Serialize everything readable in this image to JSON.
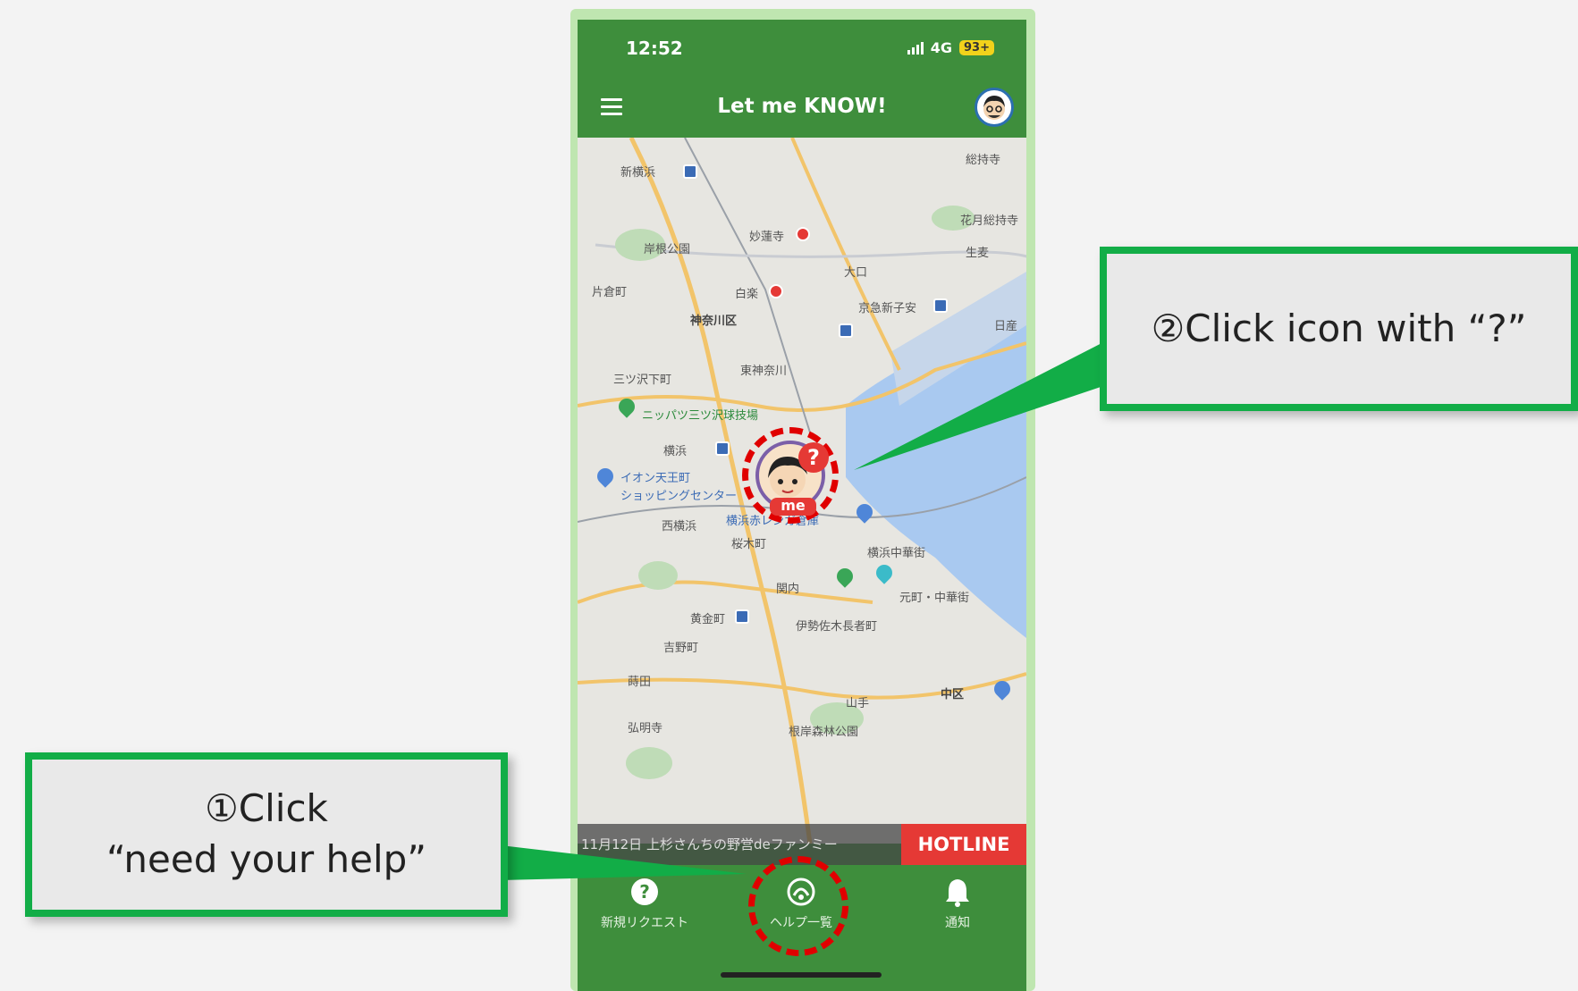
{
  "status": {
    "time": "12:52",
    "network": "4G",
    "battery": "93+"
  },
  "app_bar": {
    "title": "Let me KNOW!"
  },
  "map": {
    "labels": [
      {
        "text": "新横浜",
        "style": "",
        "anchor": "top-left"
      },
      {
        "text": "妙蓮寺",
        "style": ""
      },
      {
        "text": "岸根公園",
        "style": ""
      },
      {
        "text": "片倉町",
        "style": ""
      },
      {
        "text": "白楽",
        "style": ""
      },
      {
        "text": "神奈川区",
        "style": "bold"
      },
      {
        "text": "大口",
        "style": ""
      },
      {
        "text": "京急新子安",
        "style": ""
      },
      {
        "text": "東神奈川",
        "style": ""
      },
      {
        "text": "三ツ沢下町",
        "style": ""
      },
      {
        "text": "ニッパツ三ツ沢球技場",
        "style": "green"
      },
      {
        "text": "横浜",
        "style": ""
      },
      {
        "text": "イオン天王町",
        "style": "blue"
      },
      {
        "text": "ショッピングセンター",
        "style": "blue"
      },
      {
        "text": "西横浜",
        "style": ""
      },
      {
        "text": "横浜赤レンガ倉庫",
        "style": "blue"
      },
      {
        "text": "桜木町",
        "style": ""
      },
      {
        "text": "横浜中華街",
        "style": ""
      },
      {
        "text": "関内",
        "style": ""
      },
      {
        "text": "元町・中華街",
        "style": ""
      },
      {
        "text": "黄金町",
        "style": ""
      },
      {
        "text": "伊勢佐木長者町",
        "style": ""
      },
      {
        "text": "吉野町",
        "style": ""
      },
      {
        "text": "蒔田",
        "style": ""
      },
      {
        "text": "中区",
        "style": "bold"
      },
      {
        "text": "山手",
        "style": ""
      },
      {
        "text": "根岸森林公園",
        "style": ""
      },
      {
        "text": "弘明寺",
        "style": ""
      },
      {
        "text": "総持寺",
        "style": ""
      },
      {
        "text": "花月総持寺",
        "style": ""
      },
      {
        "text": "生麦",
        "style": ""
      },
      {
        "text": "日産",
        "style": ""
      }
    ],
    "me_marker": {
      "badge": "?",
      "tag": "me"
    }
  },
  "hotline": {
    "ticker": "11月12日 上杉さんちの野営deファンミー",
    "button": "HOTLINE"
  },
  "bottom_nav": [
    {
      "label": "新規リクエスト",
      "icon": "question-circle-icon"
    },
    {
      "label": "ヘルプ一覧",
      "icon": "help-list-icon"
    },
    {
      "label": "通知",
      "icon": "bell-icon"
    }
  ],
  "callouts": {
    "step1": {
      "line1": "①Click",
      "line2": "“need your help”"
    },
    "step2": {
      "line1": "②Click icon with “?”"
    }
  },
  "colors": {
    "app_green": "#3e8e3c",
    "callout_border": "#12ad47",
    "highlight_red": "#e00000",
    "hotline_red": "#e53935"
  }
}
